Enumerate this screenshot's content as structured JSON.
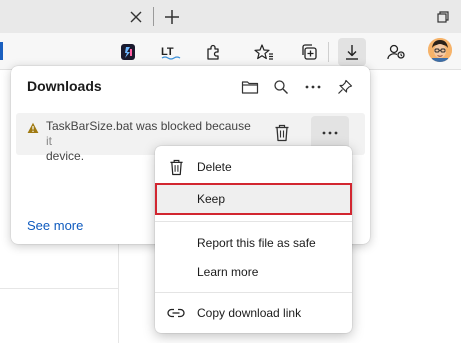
{
  "browser": {
    "tab_close_glyph": "✕",
    "new_tab_glyph": "+",
    "toolbar_icons": [
      "extension-app-icon",
      "text-tool-icon",
      "puzzle-extensions-icon",
      "favorites-icon",
      "collections-icon",
      "downloads-icon",
      "profile-sync-icon"
    ],
    "text_tool_label": "LT"
  },
  "downloads": {
    "title": "Downloads",
    "header_icons": [
      "folder-icon",
      "search-icon",
      "more-options-icon",
      "pin-icon"
    ],
    "item": {
      "line1": "TaskBarSize.bat was blocked because",
      "line1_faded": " it",
      "line2": "device."
    },
    "see_more": "See more"
  },
  "context_menu": {
    "items": [
      {
        "label": "Delete",
        "icon": "trash-icon"
      },
      {
        "label": "Keep",
        "icon": ""
      },
      {
        "label": "Report this file as safe",
        "icon": ""
      },
      {
        "label": "Learn more",
        "icon": ""
      },
      {
        "label": "Copy download link",
        "icon": "link-icon"
      }
    ],
    "highlighted": "Keep"
  },
  "colors": {
    "accent_link": "#0f5bbf",
    "warning": "#a07a12",
    "highlight_outline": "#d22630"
  }
}
